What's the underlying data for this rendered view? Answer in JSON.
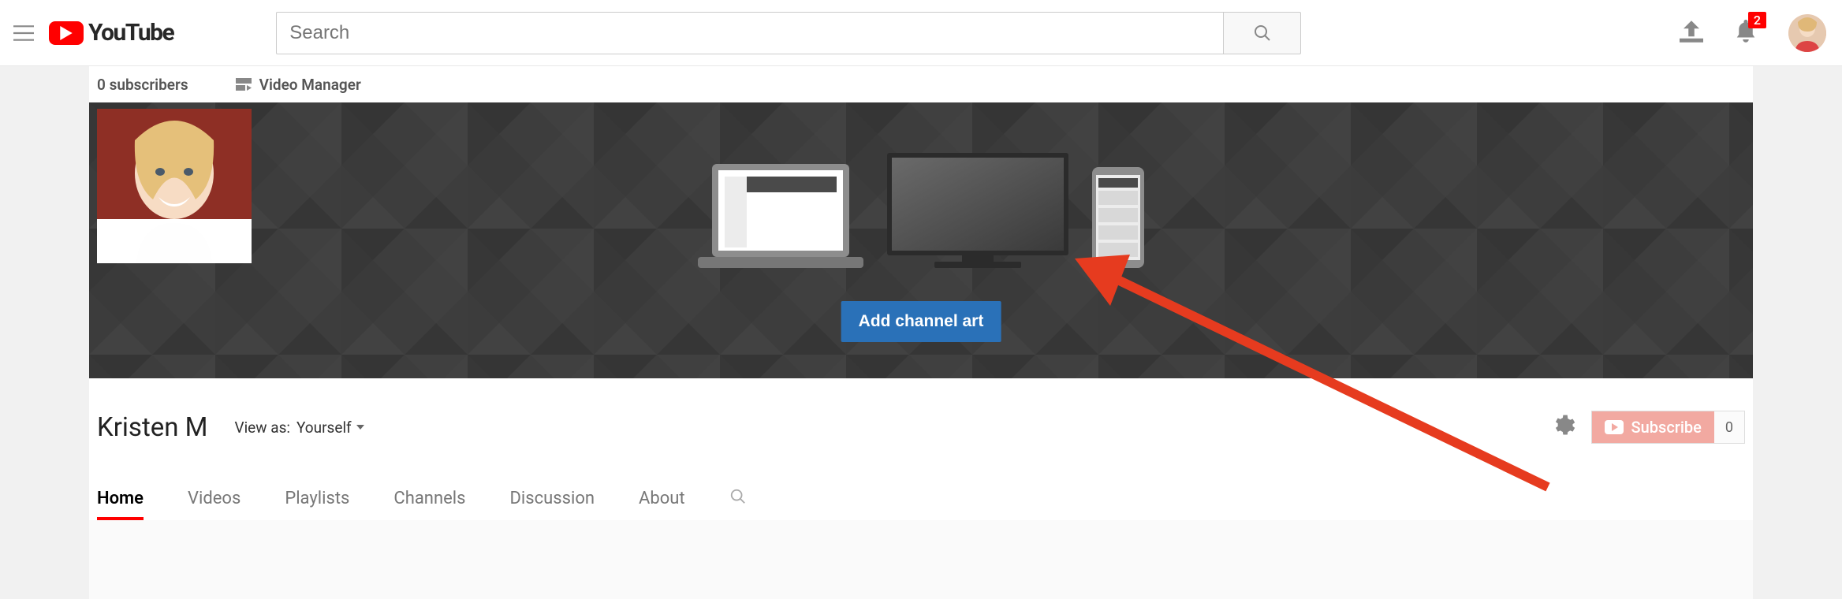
{
  "header": {
    "logo_text": "YouTube",
    "search_placeholder": "Search",
    "notification_count": "2"
  },
  "topbar": {
    "subscribers": "0 subscribers",
    "video_manager": "Video Manager"
  },
  "banner": {
    "add_art_label": "Add channel art"
  },
  "channel": {
    "name": "Kristen M",
    "viewas_label": "View as:",
    "viewas_value": "Yourself",
    "subscribe_label": "Subscribe",
    "subscriber_count": "0"
  },
  "tabs": {
    "items": [
      "Home",
      "Videos",
      "Playlists",
      "Channels",
      "Discussion",
      "About"
    ],
    "active_index": 0
  }
}
